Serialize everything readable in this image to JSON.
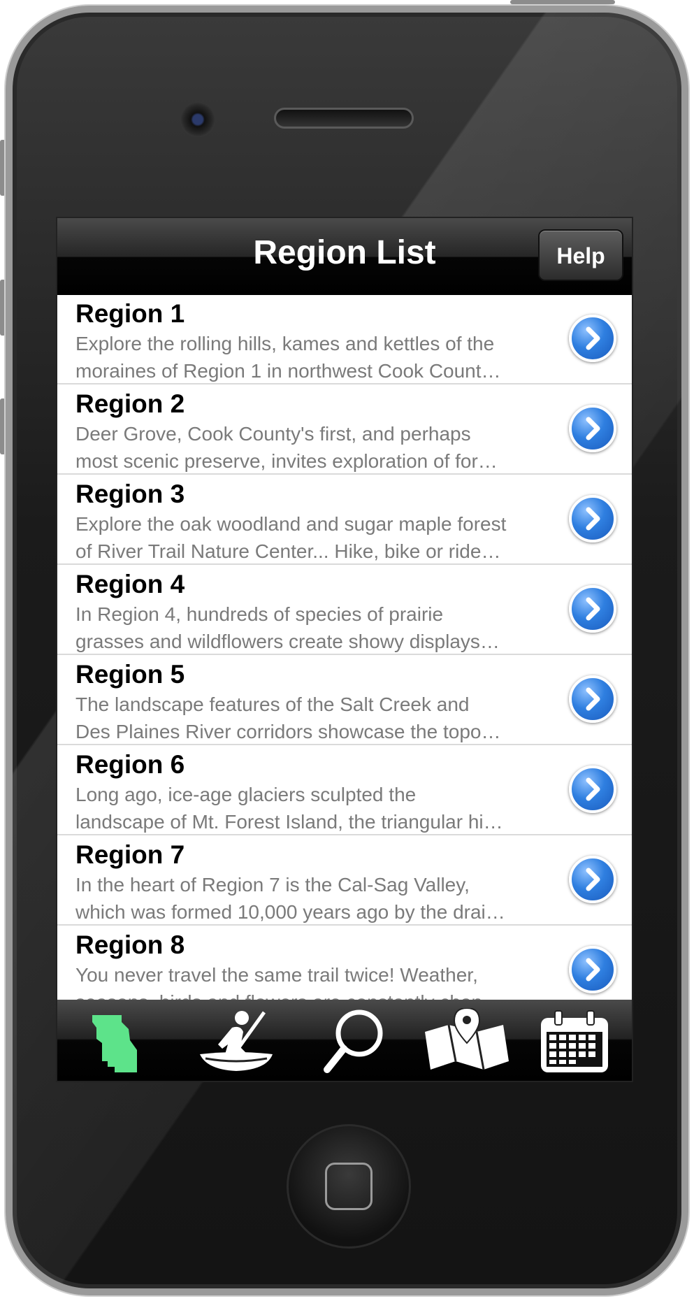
{
  "nav": {
    "title": "Region List",
    "help_label": "Help"
  },
  "regions": [
    {
      "title": "Region 1",
      "description": "Explore the rolling hills, kames and kettles of the\nmoraines of Region 1 in northwest Cook Count…"
    },
    {
      "title": "Region 2",
      "description": "Deer Grove, Cook County's first, and perhaps\nmost scenic preserve, invites exploration of for…"
    },
    {
      "title": "Region 3",
      "description": "Explore the oak woodland and sugar maple forest\nof River Trail Nature Center... Hike, bike or ride…"
    },
    {
      "title": "Region 4",
      "description": "In Region 4, hundreds of species of prairie\ngrasses and wildflowers create showy displays…"
    },
    {
      "title": "Region 5",
      "description": "The landscape features of the Salt Creek and\nDes Plaines River corridors showcase the topo…"
    },
    {
      "title": "Region 6",
      "description": "Long ago, ice-age glaciers sculpted the\nlandscape of Mt. Forest Island, the triangular hi…"
    },
    {
      "title": "Region 7",
      "description": " In the heart of Region 7 is the Cal-Sag Valley,\nwhich was formed 10,000 years ago by the drai…"
    },
    {
      "title": "Region 8",
      "description": "You never travel the same trail twice! Weather,\nseasons, birds and flowers are constantly chan…"
    }
  ],
  "tabs": [
    {
      "icon": "region-map-icon",
      "selected": true
    },
    {
      "icon": "canoe-icon",
      "selected": false
    },
    {
      "icon": "search-icon",
      "selected": false
    },
    {
      "icon": "map-pin-icon",
      "selected": false
    },
    {
      "icon": "calendar-icon",
      "selected": false
    }
  ],
  "colors": {
    "selected_tab": "#5de38a",
    "accent_blue": "#2f7fe0",
    "nav_bg": "#000000"
  }
}
